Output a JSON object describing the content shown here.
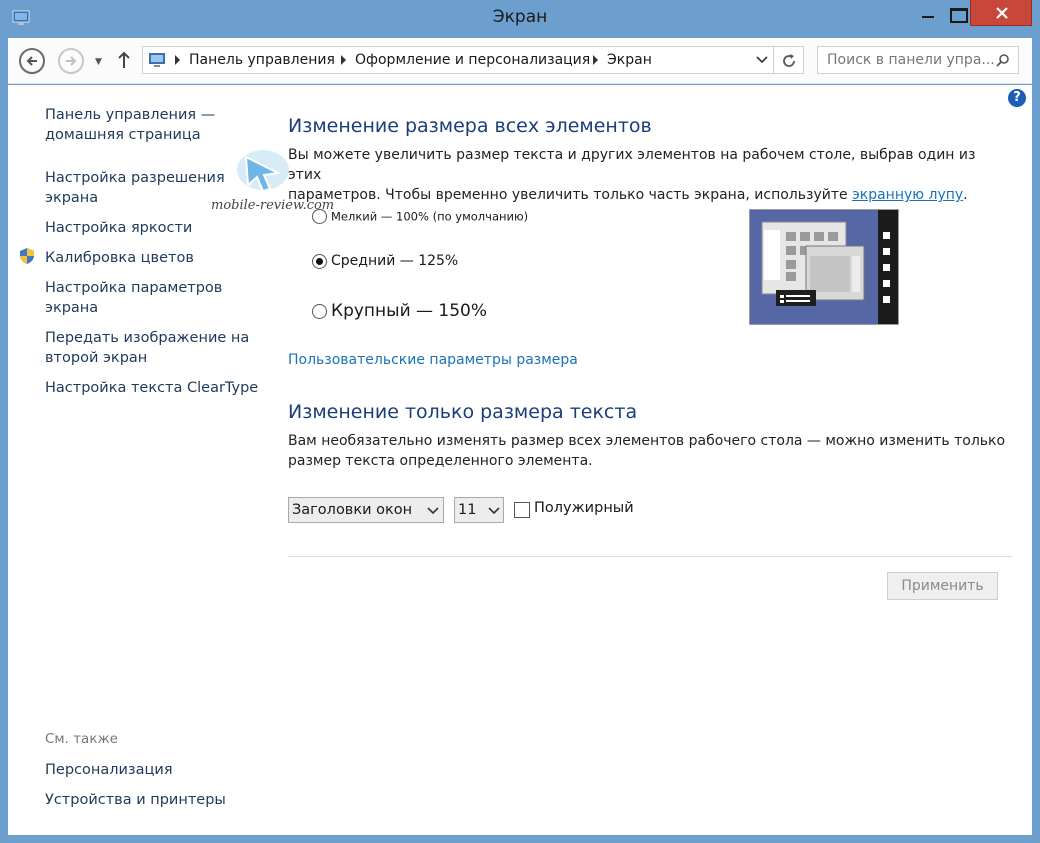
{
  "window": {
    "title": "Экран",
    "icon": "display-icon"
  },
  "navigation": {
    "breadcrumb": [
      "Панель управления",
      "Оформление и персонализация",
      "Экран"
    ],
    "search_placeholder": "Поиск в панели упра..."
  },
  "sidebar": {
    "items": [
      "Панель управления —",
      "домашняя страница",
      "Настройка разрешения",
      "экрана",
      "Настройка яркости",
      "Калибровка цветов",
      "Настройка параметров",
      "экрана",
      "Передать изображение на",
      "второй экран",
      "Настройка текста ClearType"
    ],
    "see_also_label": "См. также",
    "see_also": [
      "Персонализация",
      "Устройства и принтеры"
    ]
  },
  "watermark": "mobile-review.com",
  "main": {
    "section1": {
      "title": "Изменение размера всех элементов",
      "desc_line1": "Вы можете увеличить размер текста и других элементов на рабочем столе, выбрав один из этих",
      "desc_line2": "параметров. Чтобы временно увеличить только часть экрана, используйте",
      "desc_link": "экранную лупу",
      "desc_end": ".",
      "options": [
        {
          "label": "Мелкий — 100% (по умолчанию)",
          "selected": false
        },
        {
          "label": "Средний — 125%",
          "selected": true
        },
        {
          "label": "Крупный — 150%",
          "selected": false
        }
      ],
      "custom_link": "Пользовательские параметры размера"
    },
    "section2": {
      "title": "Изменение только размера текста",
      "desc_line1": "Вам необязательно изменять размер всех элементов рабочего стола — можно изменить только",
      "desc_line2": "размер текста определенного элемента.",
      "element_select": "Заголовки окон",
      "size_select": "11",
      "bold_label": "Полужирный",
      "bold_checked": false
    },
    "apply_label": "Применить"
  },
  "colors": {
    "accent_title": "#1b3e78",
    "link": "#1874b7",
    "close_button": "#c7473a",
    "frame": "#6c9fcd"
  }
}
